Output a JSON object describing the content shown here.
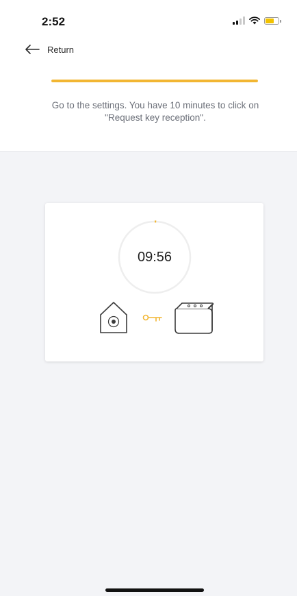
{
  "status_bar": {
    "time": "2:52",
    "battery_level": 0.6
  },
  "nav": {
    "back_label": "Return"
  },
  "progress": {
    "fraction": 1.0,
    "color": "#f2b632"
  },
  "instruction": {
    "text": "Go to the settings. You have 10 minutes to click on \"Request key reception\"."
  },
  "timer": {
    "display": "09:56",
    "remaining_fraction": 0.993
  },
  "pairing_icons": [
    "home-hub-icon",
    "key-icon",
    "lock-module-icon"
  ],
  "colors": {
    "accent": "#f2b632",
    "text_muted": "#6b6f78",
    "background_gray": "#f3f4f7"
  }
}
